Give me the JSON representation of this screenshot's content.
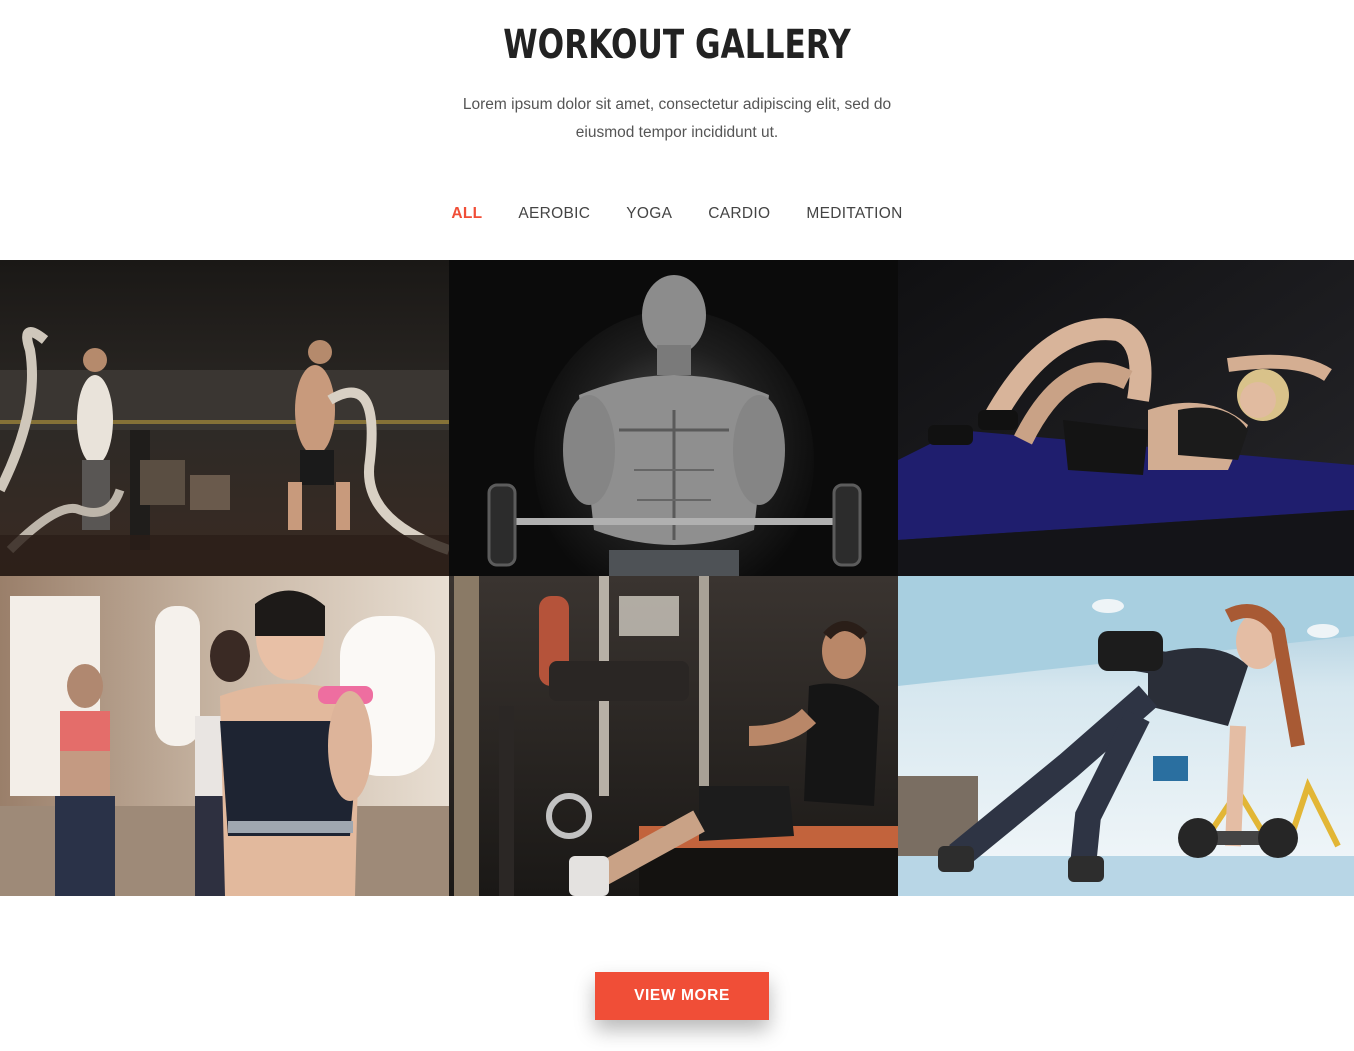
{
  "header": {
    "title": "WORKOUT GALLERY",
    "subtitle_line1": "Lorem ipsum dolor sit amet, consectetur adipiscing elit, sed do",
    "subtitle_line2": "eiusmod tempor incididunt ut."
  },
  "filters": [
    {
      "label": "ALL",
      "active": true
    },
    {
      "label": "AEROBIC",
      "active": false
    },
    {
      "label": "YOGA",
      "active": false
    },
    {
      "label": "CARDIO",
      "active": false
    },
    {
      "label": "MEDITATION",
      "active": false
    }
  ],
  "gallery": [
    {
      "subject": "battle-ropes-photo"
    },
    {
      "subject": "barbell-curl-photo"
    },
    {
      "subject": "crunches-mat-photo"
    },
    {
      "subject": "dumbbell-class-photo"
    },
    {
      "subject": "cable-row-photo"
    },
    {
      "subject": "dumbbell-plank-row-photo"
    }
  ],
  "cta": {
    "label": "VIEW MORE"
  },
  "colors": {
    "accent": "#f04e37",
    "heading": "#222222",
    "text": "#555555"
  }
}
